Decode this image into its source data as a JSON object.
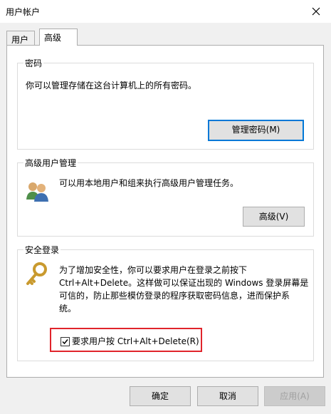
{
  "window": {
    "title": "用户帐户"
  },
  "tabs": [
    {
      "label": "用户",
      "active": false
    },
    {
      "label": "高级",
      "active": true
    }
  ],
  "password_group": {
    "legend": "密码",
    "description": "你可以管理存储在这台计算机上的所有密码。",
    "button_label": "管理密码(M)"
  },
  "advanced_user_group": {
    "legend": "高级用户管理",
    "description": "可以用本地用户和组来执行高级用户管理任务。",
    "button_label": "高级(V)",
    "icon": "users-icon"
  },
  "secure_logon_group": {
    "legend": "安全登录",
    "description_lines": [
      "为了增加安全性，你可以要求用户在登录之前按下",
      "Ctrl+Alt+Delete。这样做可以保证出现的 Windows 登录屏幕是",
      "可信的，防止那些模仿登录的程序获取密码信息，进而保护系",
      "统。"
    ],
    "checkbox_label": "要求用户按 Ctrl+Alt+Delete(R)",
    "checkbox_checked": true,
    "icon": "key-icon",
    "highlight_color": "#e0242b"
  },
  "footer": {
    "ok_label": "确定",
    "cancel_label": "取消",
    "apply_label": "应用(A)"
  },
  "colors": {
    "accent": "#0078d7",
    "window_bg": "#f0f0f0"
  }
}
